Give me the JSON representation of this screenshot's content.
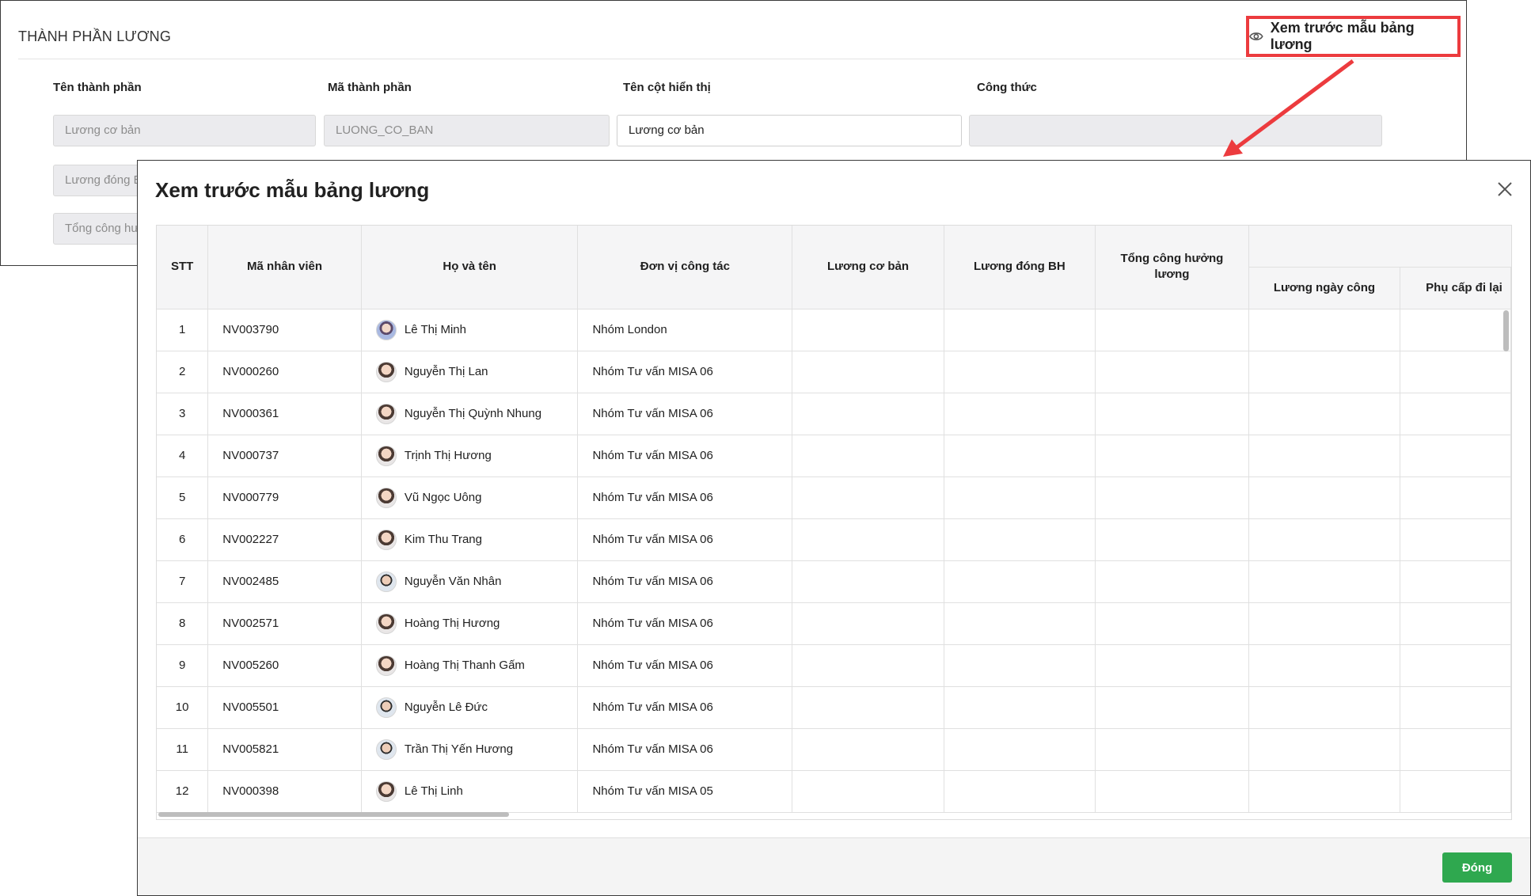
{
  "section_title": "THÀNH PHẦN LƯƠNG",
  "preview_link": {
    "label": "Xem trước mẫu bảng lương",
    "icon": "eye-icon"
  },
  "form": {
    "labels": {
      "component_name": "Tên thành phần",
      "component_code": "Mã thành phần",
      "display_column": "Tên cột hiển thị",
      "formula": "Công thức"
    },
    "rows": [
      {
        "name": "Lương cơ bản",
        "code": "LUONG_CO_BAN",
        "display": "Lương cơ bản",
        "formula": ""
      },
      {
        "name": "Lương đóng BH"
      },
      {
        "name": "Tổng công hưởng lương"
      }
    ]
  },
  "dialog": {
    "title": "Xem trước mẫu bảng lương",
    "close_label": "Đóng",
    "columns": {
      "stt": "STT",
      "employee_code": "Mã nhân viên",
      "full_name": "Họ và tên",
      "unit": "Đơn vị công tác",
      "base_salary": "Lương cơ bản",
      "insurance_salary": "Lương đóng BH",
      "paid_workdays": "Tổng công hưởng lương",
      "workday_salary": "Lương ngày công",
      "allowance": "Phụ cấp đi lại"
    },
    "rows": [
      {
        "stt": "1",
        "code": "NV003790",
        "name": "Lê Thị Minh",
        "unit": "Nhóm London"
      },
      {
        "stt": "2",
        "code": "NV000260",
        "name": "Nguyễn Thị Lan",
        "unit": "Nhóm Tư vấn MISA 06"
      },
      {
        "stt": "3",
        "code": "NV000361",
        "name": "Nguyễn Thị Quỳnh Nhung",
        "unit": "Nhóm Tư vấn MISA 06"
      },
      {
        "stt": "4",
        "code": "NV000737",
        "name": "Trịnh Thị Hương",
        "unit": "Nhóm Tư vấn MISA 06"
      },
      {
        "stt": "5",
        "code": "NV000779",
        "name": "Vũ Ngọc Uông",
        "unit": "Nhóm Tư vấn MISA 06"
      },
      {
        "stt": "6",
        "code": "NV002227",
        "name": "Kim Thu Trang",
        "unit": "Nhóm Tư vấn MISA 06"
      },
      {
        "stt": "7",
        "code": "NV002485",
        "name": "Nguyễn Văn Nhân",
        "unit": "Nhóm Tư vấn MISA 06"
      },
      {
        "stt": "8",
        "code": "NV002571",
        "name": "Hoàng Thị Hương",
        "unit": "Nhóm Tư vấn MISA 06"
      },
      {
        "stt": "9",
        "code": "NV005260",
        "name": "Hoàng Thị Thanh Gấm",
        "unit": "Nhóm Tư vấn MISA 06"
      },
      {
        "stt": "10",
        "code": "NV005501",
        "name": "Nguyễn Lê Đức",
        "unit": "Nhóm Tư vấn MISA 06"
      },
      {
        "stt": "11",
        "code": "NV005821",
        "name": "Trần Thị Yến Hương",
        "unit": "Nhóm Tư vấn MISA 06"
      },
      {
        "stt": "12",
        "code": "NV000398",
        "name": "Lê Thị Linh",
        "unit": "Nhóm Tư vấn MISA 05"
      }
    ]
  },
  "colors": {
    "highlight": "#ec3b3e",
    "primary_button": "#2fa84f"
  }
}
